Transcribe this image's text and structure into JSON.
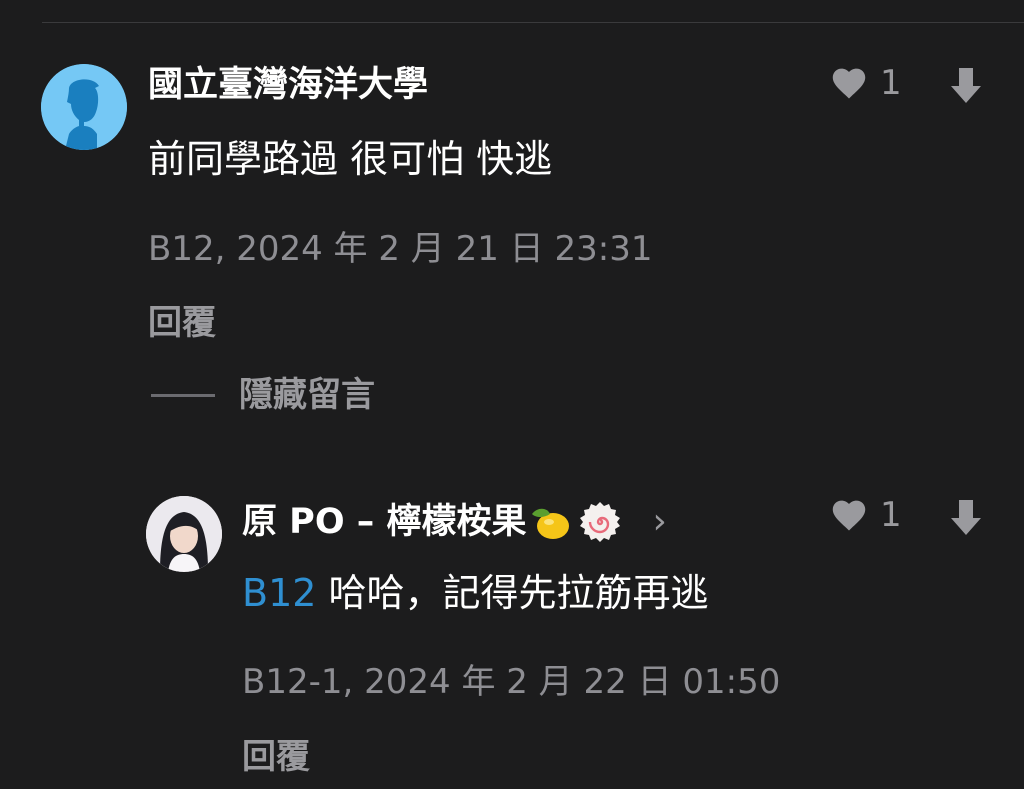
{
  "comment": {
    "author": "國立臺灣海洋大學",
    "text": "前同學路過 很可怕 快逃",
    "meta": "B12, 2024 年 2 月 21 日 23:31",
    "likes": "1",
    "reply_label": "回覆",
    "hide_label": "隱藏留言"
  },
  "reply": {
    "author": "原 PO – 檸檬桉果",
    "author_emojis": [
      "lemon-emoji",
      "naruto-fishcake-emoji"
    ],
    "chevron": "›",
    "mention": "B12",
    "text": " 哈哈，記得先拉筋再逃",
    "meta": "B12-1, 2024 年 2 月 22 日 01:50",
    "likes": "1",
    "reply_label": "回覆"
  },
  "colors": {
    "background": "#1c1c1d",
    "mention": "#2f8fd1",
    "avatar_default": "#75c8f5",
    "muted_text": "#8e8e93"
  }
}
